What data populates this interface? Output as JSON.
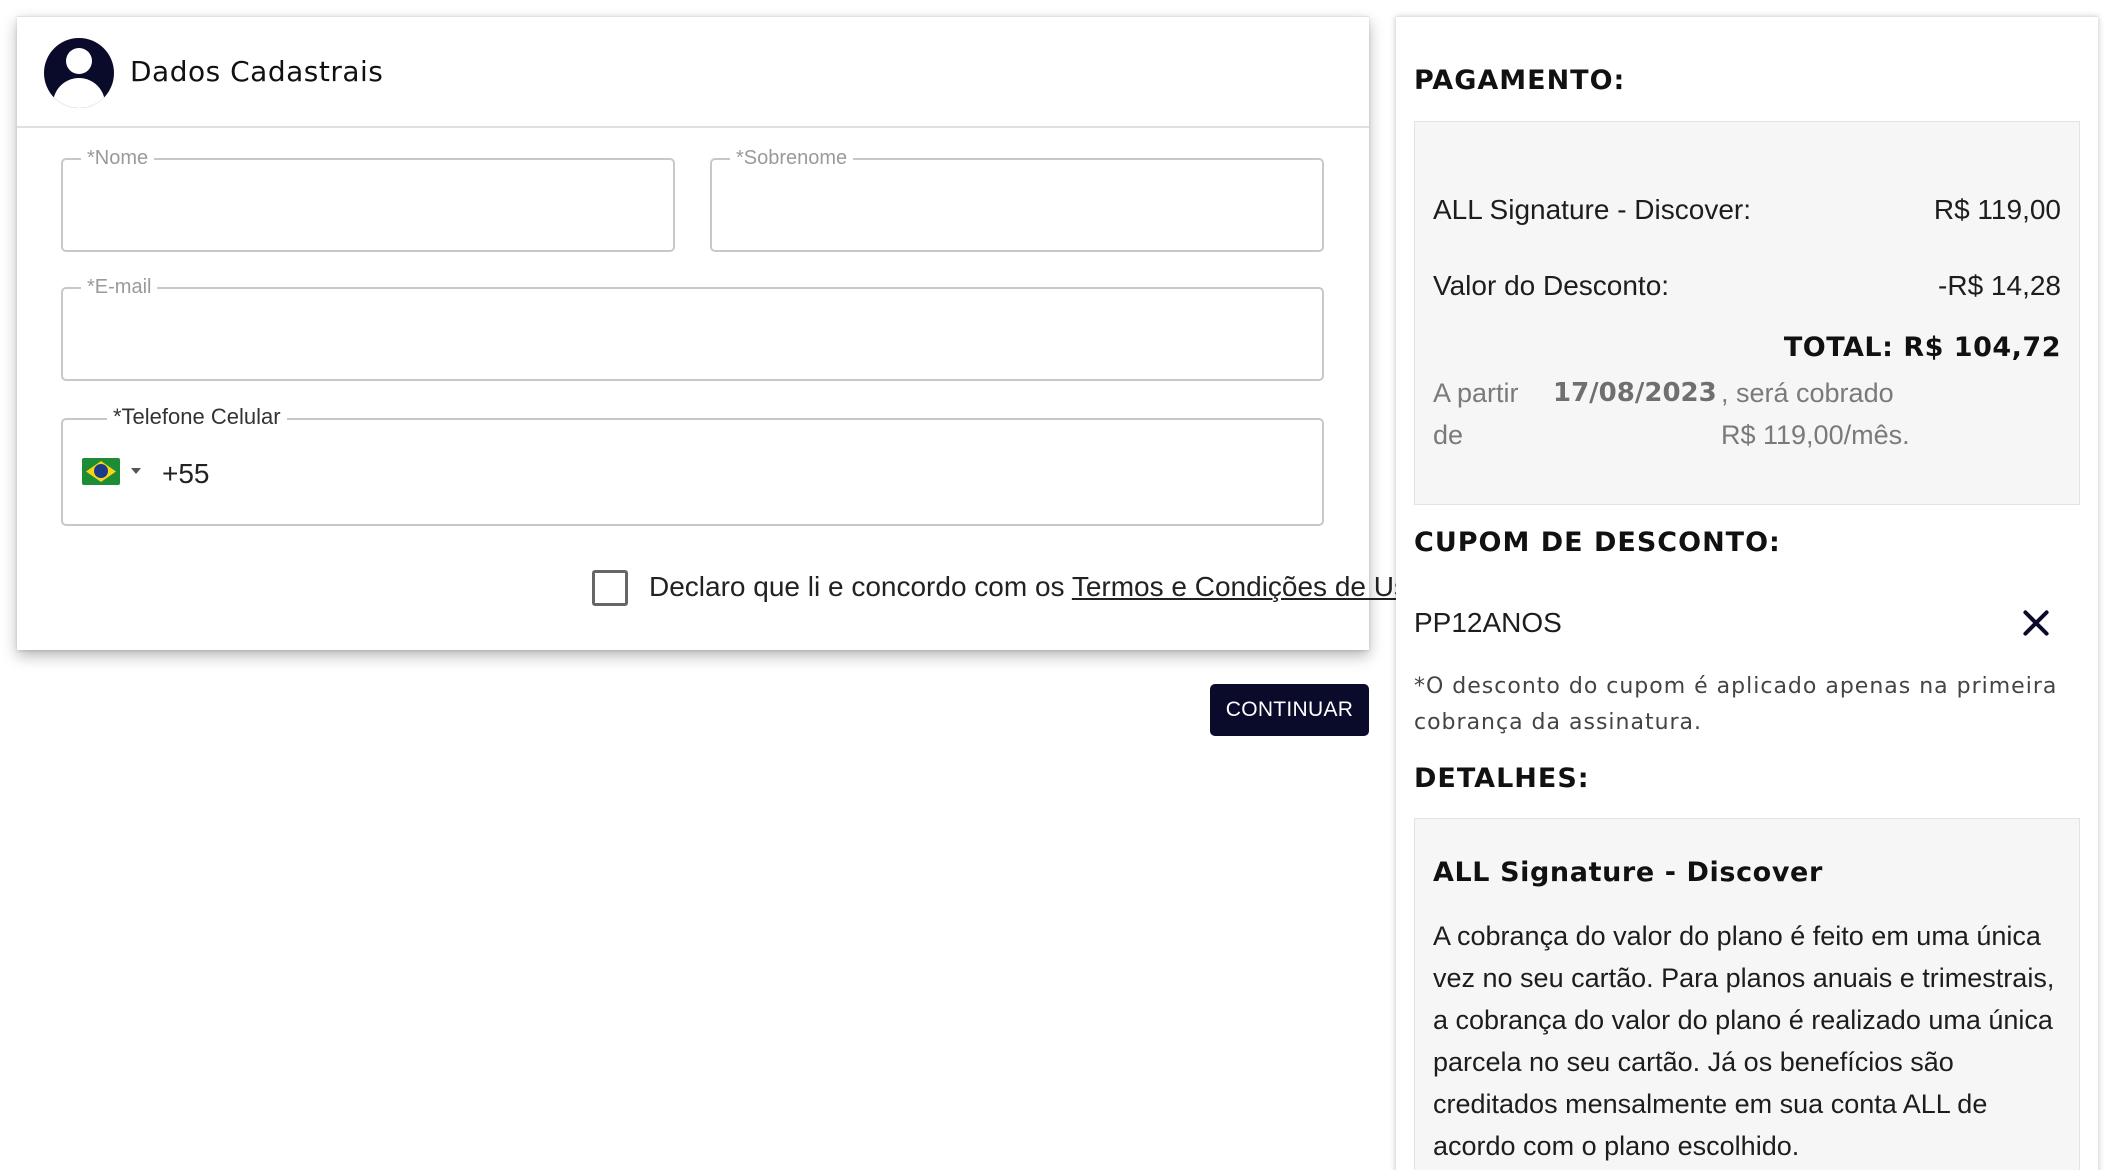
{
  "registration": {
    "title": "Dados Cadastrais",
    "fields": {
      "first_name": {
        "label": "*Nome",
        "value": ""
      },
      "last_name": {
        "label": "*Sobrenome",
        "value": ""
      },
      "email": {
        "label": "*E-mail",
        "value": ""
      },
      "phone": {
        "label": "*Telefone Celular",
        "country_code": "+55",
        "country_flag_icon": "brazil-flag-icon"
      }
    },
    "terms": {
      "text": "Declaro que li e concordo com os ",
      "link_label": "Termos e Condições de Uso",
      "checked": false
    },
    "continue_label": "CONTINUAR"
  },
  "payment": {
    "title": "PAGAMENTO:",
    "rows": [
      {
        "label": "ALL Signature - Discover:",
        "value": "R$ 119,00"
      },
      {
        "label": "Valor do Desconto:",
        "value": "-R$ 14,28"
      }
    ],
    "total": "TOTAL: R$ 104,72",
    "notice": {
      "prefix_line1": "A partir",
      "prefix_line2": "de",
      "date": "17/08/2023",
      "suffix_line1": ", será cobrado",
      "suffix_line2": "R$ 119,00/mês."
    }
  },
  "coupon": {
    "title": "CUPOM DE DESCONTO:",
    "code": "PP12ANOS",
    "remove_icon": "close-icon",
    "note": "*O desconto do cupom é aplicado apenas na primeira cobrança da assinatura."
  },
  "details": {
    "title": "DETALHES:",
    "plan_name": "ALL Signature - Discover",
    "description": "A cobrança do valor do plano é feito em uma única vez no seu cartão. Para planos anuais e trimestrais, a cobrança do valor do plano é realizado uma única parcela no seu cartão. Já os benefícios são creditados mensalmente em sua conta ALL de acordo com o plano escolhido."
  },
  "colors": {
    "brand_dark": "#0a0a2a",
    "panel_bg": "#f6f6f6",
    "field_border": "#c8c8c8"
  }
}
